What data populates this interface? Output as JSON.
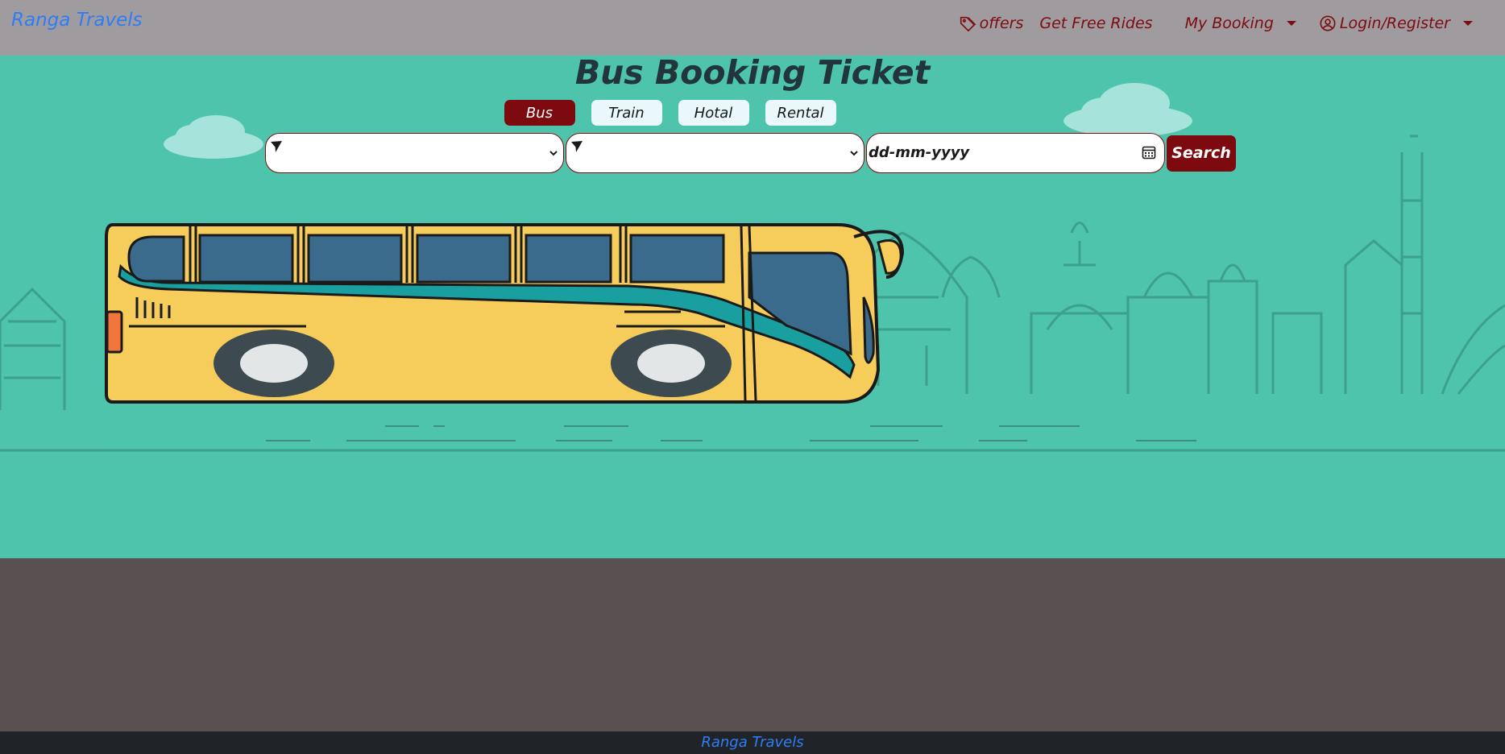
{
  "navbar": {
    "brand": "Ranga Travels",
    "links": [
      {
        "label": "offers",
        "icon": "tag-icon"
      },
      {
        "label": "Get Free Rides"
      },
      {
        "label": "My Booking",
        "dropdown": true
      },
      {
        "label": "Login/Register",
        "icon": "user-circle-icon",
        "dropdown": true
      }
    ]
  },
  "hero": {
    "title": "Bus Booking Ticket",
    "tabs": [
      {
        "label": "Bus",
        "active": true
      },
      {
        "label": "Train",
        "active": false
      },
      {
        "label": "Hotal",
        "active": false
      },
      {
        "label": "Rental",
        "active": false
      }
    ],
    "search": {
      "from_value": "",
      "to_value": "",
      "date_placeholder": "dd-mm-yyyy",
      "button_label": "Search"
    }
  },
  "footer": {
    "brand": "Ranga Travels"
  },
  "colors": {
    "navbar_bg": "#a09b9e",
    "hero_bg": "#4dc4ab",
    "accent": "#7c0a0f",
    "brand_link": "#2f7df6",
    "footer_bg": "#202428",
    "middle_bg": "#5a5052"
  }
}
